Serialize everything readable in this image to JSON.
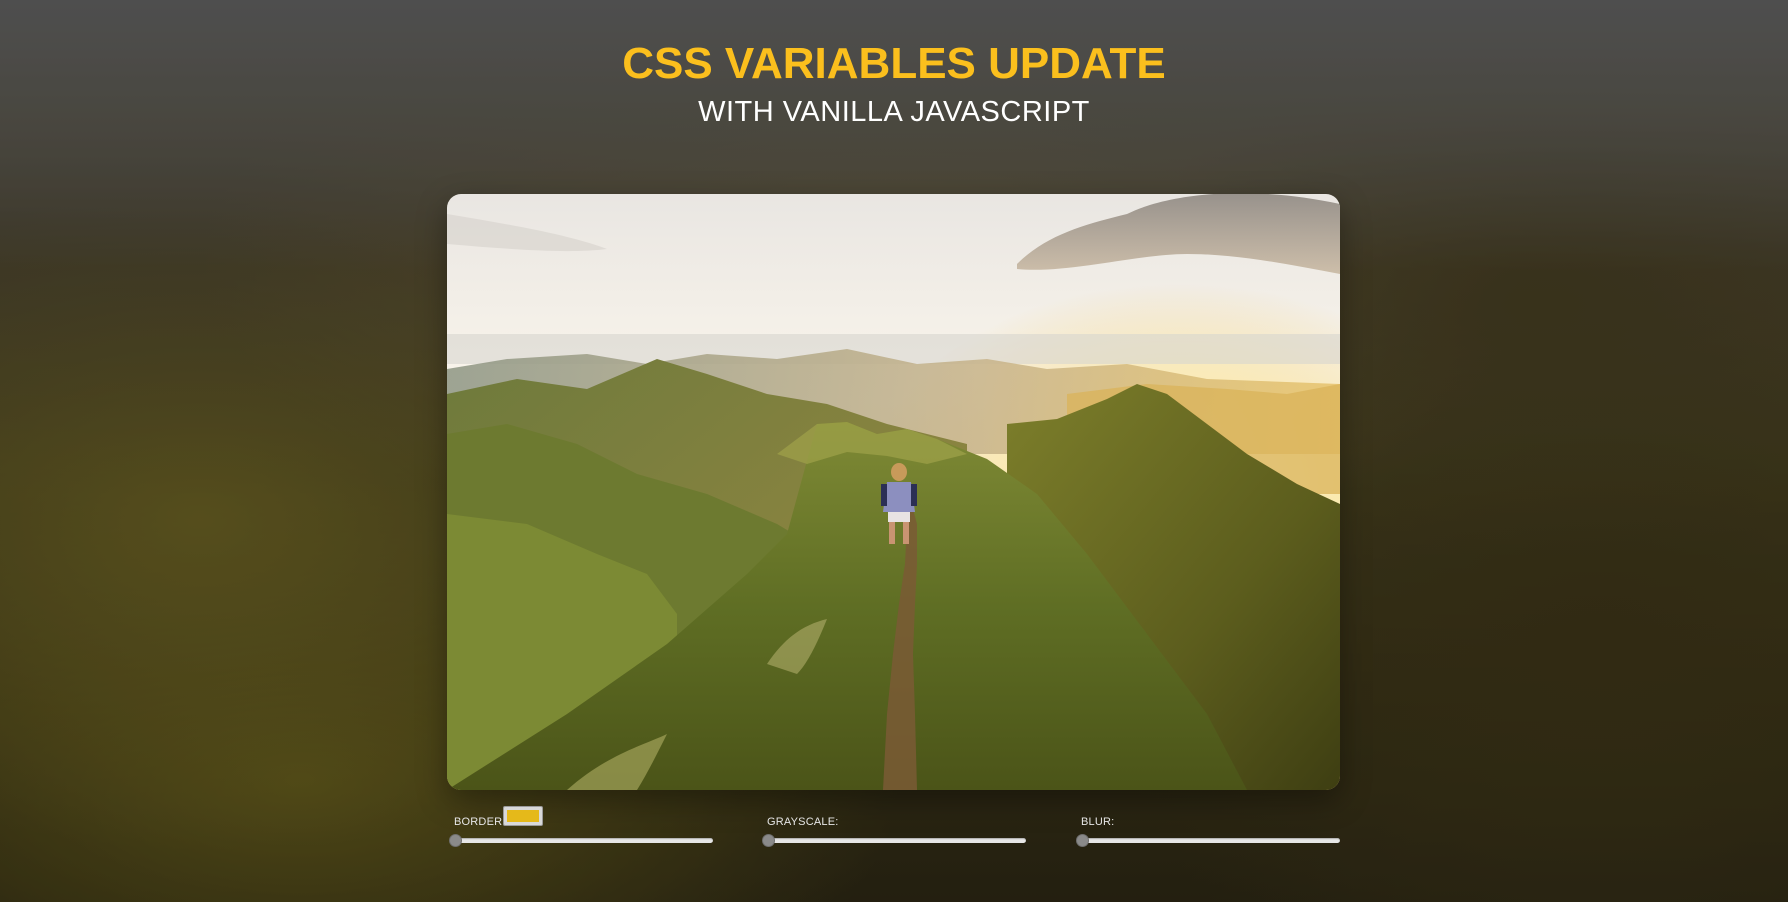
{
  "header": {
    "title": "CSS VARIABLES UPDATE",
    "subtitle": "WITH VANILLA JAVASCRIPT"
  },
  "colors": {
    "accent": "#fbbf1d",
    "border_swatch": "#e5b91a",
    "text": "#ffffff"
  },
  "photo": {
    "subject": "hiker-on-mountain-ridge-at-sunset"
  },
  "controls": {
    "border": {
      "label": "BORDER",
      "color": "#e5b91a",
      "value": 0
    },
    "grayscale": {
      "label": "GRAYSCALE:",
      "value": 0
    },
    "blur": {
      "label": "BLUR:",
      "value": 0
    }
  }
}
